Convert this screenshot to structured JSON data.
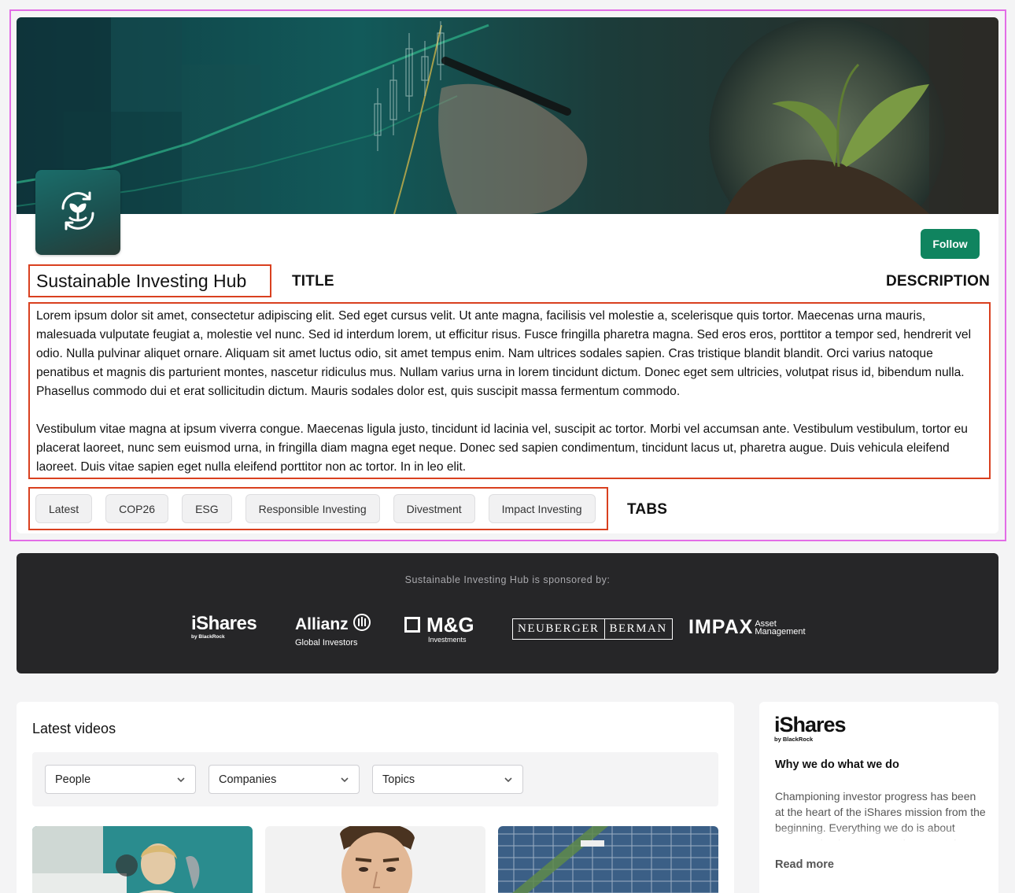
{
  "hub": {
    "title": "Sustainable Investing Hub",
    "follow_label": "Follow",
    "description": [
      "Lorem ipsum dolor sit amet, consectetur adipiscing elit. Sed eget cursus velit. Ut ante magna, facilisis vel molestie a, scelerisque quis tortor. Maecenas urna mauris, malesuada vulputate feugiat a, molestie vel nunc. Sed id interdum lorem, ut efficitur risus. Fusce fringilla pharetra magna. Sed eros eros, porttitor a tempor sed, hendrerit vel odio. Nulla pulvinar aliquet ornare. Aliquam sit amet luctus odio, sit amet tempus enim. Nam ultrices sodales sapien. Cras tristique blandit blandit. Orci varius natoque penatibus et magnis dis parturient montes, nascetur ridiculus mus. Nullam varius urna in lorem tincidunt dictum. Donec eget sem ultricies, volutpat risus id, bibendum nulla. Phasellus commodo dui et erat sollicitudin dictum. Mauris sodales dolor est, quis suscipit massa fermentum commodo.",
      "Vestibulum vitae magna at ipsum viverra congue. Maecenas ligula justo, tincidunt id lacinia vel, suscipit ac tortor. Morbi vel accumsan ante. Vestibulum vestibulum, tortor eu placerat laoreet, nunc sem euismod urna, in fringilla diam magna eget neque. Donec sed sapien condimentum, tincidunt lacus ut, pharetra augue. Duis vehicula eleifend laoreet. Duis vitae sapien eget nulla eleifend porttitor non ac tortor. In in leo elit."
    ],
    "tabs": [
      "Latest",
      "COP26",
      "ESG",
      "Responsible Investing",
      "Divestment",
      "Impact Investing"
    ],
    "logo_icon": "sustainability-leaf-icon"
  },
  "annotations": {
    "title": "TITLE",
    "description": "DESCRIPTION",
    "tabs": "TABS"
  },
  "sponsors": {
    "heading": "Sustainable Investing Hub is sponsored by:",
    "logos": {
      "ishares": {
        "name": "iShares",
        "sub": "by BlackRock"
      },
      "allianz": {
        "name": "Allianz",
        "sub": "Global Investors"
      },
      "mg": {
        "name": "M&G",
        "sub": "Investments"
      },
      "neuberger": {
        "left": "NEUBERGER",
        "right": "BERMAN"
      },
      "impax": {
        "name": "IMPAX",
        "sub1": "Asset",
        "sub2": "Management"
      }
    }
  },
  "videos": {
    "title": "Latest videos",
    "filters": [
      "People",
      "Companies",
      "Topics"
    ]
  },
  "sidebar": {
    "brand": {
      "name": "iShares",
      "sub": "by BlackRock"
    },
    "heading": "Why we do what we do",
    "body": "Championing investor progress has been at the heart of the iShares mission from the beginning. Everything we do is about empowering investors so they can take",
    "read_more": "Read more"
  },
  "colors": {
    "follow": "#10845f",
    "annotation_border": "#d9401f",
    "section_outline": "#e36de6",
    "sponsor_bg": "#262628"
  }
}
